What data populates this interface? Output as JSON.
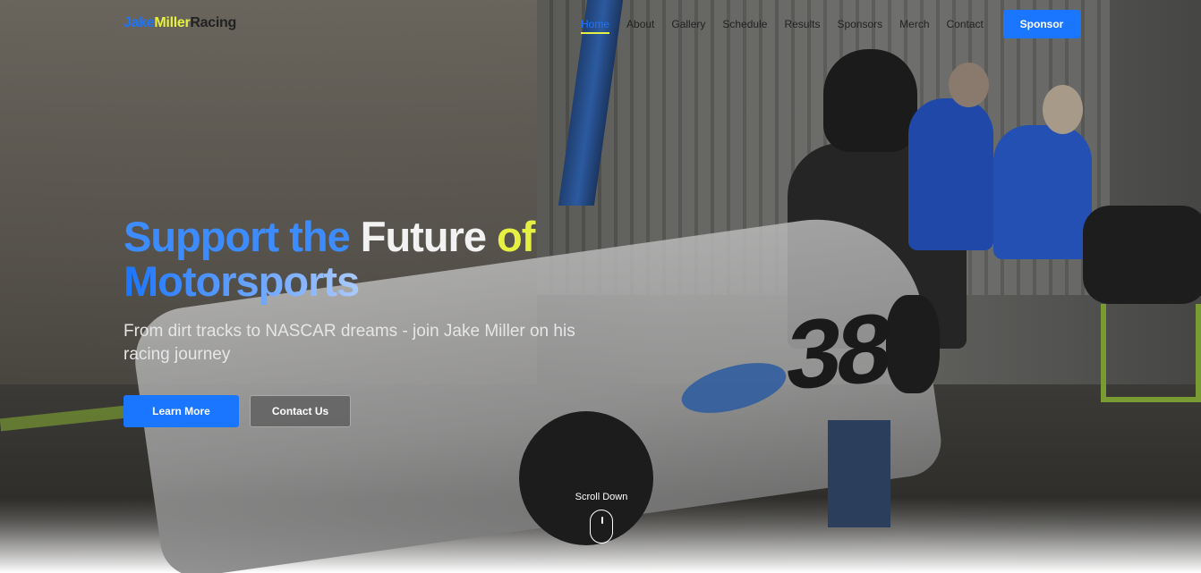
{
  "nav": {
    "logo": {
      "part1": "Jake",
      "part2": "Miller",
      "part3": "Racing"
    },
    "links": [
      "Home",
      "About",
      "Gallery",
      "Schedule",
      "Results",
      "Sponsors",
      "Merch",
      "Contact"
    ],
    "active": "Home",
    "cta_label": "Sponsor"
  },
  "hero": {
    "title": {
      "word1": "Support",
      "word2": "the",
      "word3": "Future",
      "word4": "of",
      "word5": "Motorsports"
    },
    "subtitle": "From dirt tracks to NASCAR dreams - join Jake Miller on his racing journey",
    "primary_button": "Learn More",
    "secondary_button": "Contact Us",
    "kart_number": "38"
  },
  "scroll": {
    "label": "Scroll Down"
  },
  "colors": {
    "accent_blue": "#1a75ff",
    "accent_yellow": "#e6f042"
  }
}
